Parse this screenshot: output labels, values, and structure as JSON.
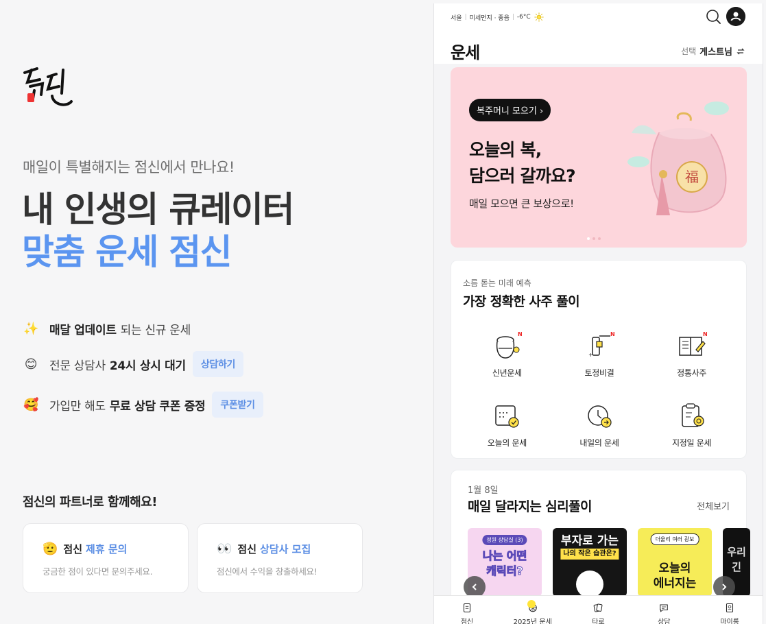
{
  "landing": {
    "logo_text": "점신",
    "subtitle": "매일이 특별해지는 점신에서 만나요!",
    "headline_1": "내 인생의 큐레이터",
    "headline_2": "맞춤 운세 점신",
    "features": [
      {
        "emoji": "✨",
        "bold": "매달 업데이트",
        "rest": "되는 신규 운세",
        "chip": ""
      },
      {
        "emoji": "😊",
        "pre": "전문 상담사",
        "bold": "24시 상시 대기",
        "chip": "상담하기"
      },
      {
        "emoji": "🥰",
        "pre": "가입만 해도",
        "bold": "무료 상담 쿠폰 증정",
        "chip": "쿠폰받기"
      }
    ],
    "partner_title": "점신의 파트너로 함께해요!",
    "partner_cards": [
      {
        "emoji": "🫡",
        "brand": "점신",
        "highlight": "제휴 문의",
        "desc": "궁금한 점이 있다면 문의주세요."
      },
      {
        "emoji": "👀",
        "brand": "점신",
        "highlight": "상담사 모집",
        "desc": "점신에서 수익을 창출하세요!"
      }
    ]
  },
  "app": {
    "weather": {
      "city": "서울",
      "dust": "미세먼지 · 좋음",
      "temp": "-6°C"
    },
    "title": "운세",
    "user_select": {
      "label": "선택",
      "user": "게스트님"
    },
    "banner": {
      "pill": "복주머니 모으기 ›",
      "headline_1": "오늘의 복,",
      "headline_2": "담으러 갈까요?",
      "sub": "매일 모으면 큰 보상으로!"
    },
    "saju": {
      "kicker": "소름 돋는 미래 예측",
      "title": "가장 정확한 사주 풀이",
      "items": [
        {
          "label": "신년운세",
          "icon": "fortune-pot-icon",
          "new": true
        },
        {
          "label": "토정비결",
          "icon": "scroll-brush-icon",
          "new": true
        },
        {
          "label": "정통사주",
          "icon": "book-pen-icon",
          "new": true
        },
        {
          "label": "오늘의 운세",
          "icon": "calendar-check-icon",
          "new": false
        },
        {
          "label": "내일의 운세",
          "icon": "clock-arrow-icon",
          "new": false
        },
        {
          "label": "지정일 운세",
          "icon": "clipboard-target-icon",
          "new": false
        }
      ],
      "new_badge": "N"
    },
    "psy": {
      "date": "1월 8일",
      "title": "매일 달라지는 심리풀이",
      "more": "전체보기",
      "thumbs": [
        {
          "tag": "정원 상담실 (3) ",
          "big_1": "나는 어떤",
          "big_2": "캐릭터?"
        },
        {
          "tag": "",
          "big_1": "부자로 가는",
          "big_2": "나의 작은 습관은?"
        },
        {
          "tag": "더울리 여러 광보",
          "big_1": "오늘의",
          "big_2": "에너지는"
        },
        {
          "tag": "",
          "big_1": "우리",
          "big_2": "긴"
        }
      ]
    },
    "tabs": [
      {
        "label": "점신",
        "icon": "phone-book-icon"
      },
      {
        "label": "2025년 운세",
        "icon": "wheel-icon"
      },
      {
        "label": "타로",
        "icon": "tarot-icon"
      },
      {
        "label": "상담",
        "icon": "chat-icon"
      },
      {
        "label": "마이룸",
        "icon": "room-icon"
      }
    ]
  }
}
